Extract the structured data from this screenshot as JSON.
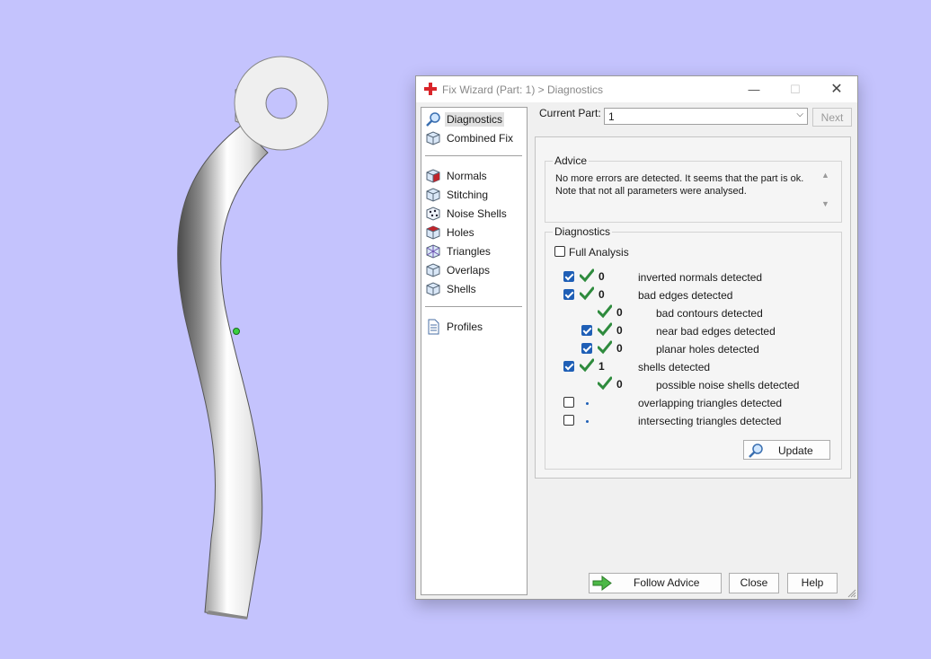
{
  "window": {
    "title": "Fix Wizard (Part: 1) > Diagnostics",
    "min_glyph": "—",
    "max_glyph": "☐",
    "close_glyph": "✕",
    "icon": "red-cross-icon"
  },
  "nav": {
    "top": [
      {
        "label": "Diagnostics",
        "icon": "magnifier-icon",
        "selected": true
      },
      {
        "label": "Combined Fix",
        "icon": "cube-icon"
      }
    ],
    "tools": [
      {
        "label": "Normals",
        "icon": "cube-red-face-icon"
      },
      {
        "label": "Stitching",
        "icon": "cube-icon"
      },
      {
        "label": "Noise Shells",
        "icon": "noise-shells-icon"
      },
      {
        "label": "Holes",
        "icon": "cube-red-face-icon"
      },
      {
        "label": "Triangles",
        "icon": "triangle-icon"
      },
      {
        "label": "Overlaps",
        "icon": "cube-icon"
      },
      {
        "label": "Shells",
        "icon": "cube-icon"
      }
    ],
    "bottom": [
      {
        "label": "Profiles",
        "icon": "document-icon"
      }
    ]
  },
  "current_part": {
    "label": "Current Part:",
    "value": "1",
    "next_label": "Next"
  },
  "advice": {
    "title": "Advice",
    "lines": [
      "No more errors are detected. It seems that the part is ok.",
      "Note that not all parameters were analysed."
    ]
  },
  "diagnostics": {
    "title": "Diagnostics",
    "full_analysis_label": "Full Analysis",
    "full_analysis_checked": false,
    "rows": [
      {
        "checkbox": true,
        "checked": true,
        "status": "ok",
        "count": "0",
        "text": "inverted normals detected",
        "indent": 0
      },
      {
        "checkbox": true,
        "checked": true,
        "status": "ok",
        "count": "0",
        "text": "bad edges detected",
        "indent": 0
      },
      {
        "checkbox": false,
        "checked": false,
        "status": "ok",
        "count": "0",
        "text": "bad contours detected",
        "indent": 1
      },
      {
        "checkbox": true,
        "checked": true,
        "status": "ok",
        "count": "0",
        "text": "near bad edges detected",
        "indent": 1
      },
      {
        "checkbox": true,
        "checked": true,
        "status": "ok",
        "count": "0",
        "text": "planar holes detected",
        "indent": 1
      },
      {
        "checkbox": true,
        "checked": true,
        "status": "ok",
        "count": "1",
        "text": "shells detected",
        "indent": 0
      },
      {
        "checkbox": false,
        "checked": false,
        "status": "ok",
        "count": "0",
        "text": "possible noise shells detected",
        "indent": 1
      },
      {
        "checkbox": true,
        "checked": false,
        "status": "pending",
        "count": "",
        "text": "overlapping triangles detected",
        "indent": 0
      },
      {
        "checkbox": true,
        "checked": false,
        "status": "pending",
        "count": "",
        "text": "intersecting triangles detected",
        "indent": 0
      }
    ],
    "update_label": "Update"
  },
  "footer": {
    "follow_advice_label": "Follow Advice",
    "close_label": "Close",
    "help_label": "Help"
  },
  "colors": {
    "background": "#c4c3fd",
    "check_green": "#2e8b3d",
    "checkbox_blue": "#1f5fb6",
    "arrow_green": "#4cb847"
  }
}
